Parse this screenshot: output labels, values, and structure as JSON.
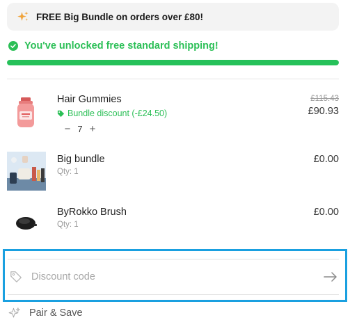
{
  "promo": {
    "icon": "sparkle-icon",
    "accent": "#f0a33a",
    "text": "FREE Big Bundle on orders over £80!"
  },
  "shipping": {
    "message": "You've unlocked free standard shipping!",
    "progress": 1.0,
    "color": "#26c15a"
  },
  "items": [
    {
      "name": "Hair Gummies",
      "discount_label": "Bundle discount (-£24.50)",
      "quantity": "7",
      "price_original": "£115.43",
      "price": "£90.93"
    },
    {
      "name": "Big bundle",
      "qty_label": "Qty: 1",
      "price": "£0.00"
    },
    {
      "name": "ByRokko Brush",
      "qty_label": "Qty: 1",
      "price": "£0.00"
    }
  ],
  "stepper": {
    "minus": "−",
    "plus": "+"
  },
  "discount": {
    "placeholder": "Discount code",
    "highlight_color": "#1aa0e0"
  },
  "pair": {
    "label": "Pair & Save"
  }
}
